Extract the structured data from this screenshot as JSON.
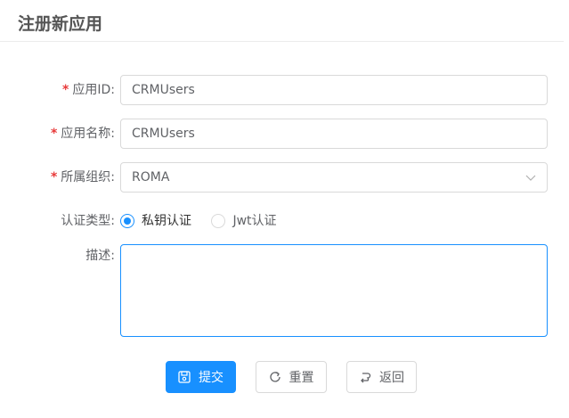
{
  "page": {
    "title": "注册新应用"
  },
  "form": {
    "app_id": {
      "label": "应用ID",
      "colon": ":",
      "required": "*",
      "value": "CRMUsers"
    },
    "app_name": {
      "label": "应用名称",
      "colon": ":",
      "required": "*",
      "value": "CRMUsers"
    },
    "org": {
      "label": "所属组织",
      "colon": ":",
      "required": "*",
      "value": "ROMA"
    },
    "auth_type": {
      "label": "认证类型",
      "colon": ":",
      "options": [
        {
          "label": "私钥认证",
          "checked": true
        },
        {
          "label": "Jwt认证",
          "checked": false
        }
      ]
    },
    "description": {
      "label": "描述",
      "colon": ":",
      "value": ""
    }
  },
  "actions": {
    "submit": "提交",
    "reset": "重置",
    "back": "返回"
  },
  "colors": {
    "primary": "#1890ff",
    "required": "#e83a3a"
  }
}
